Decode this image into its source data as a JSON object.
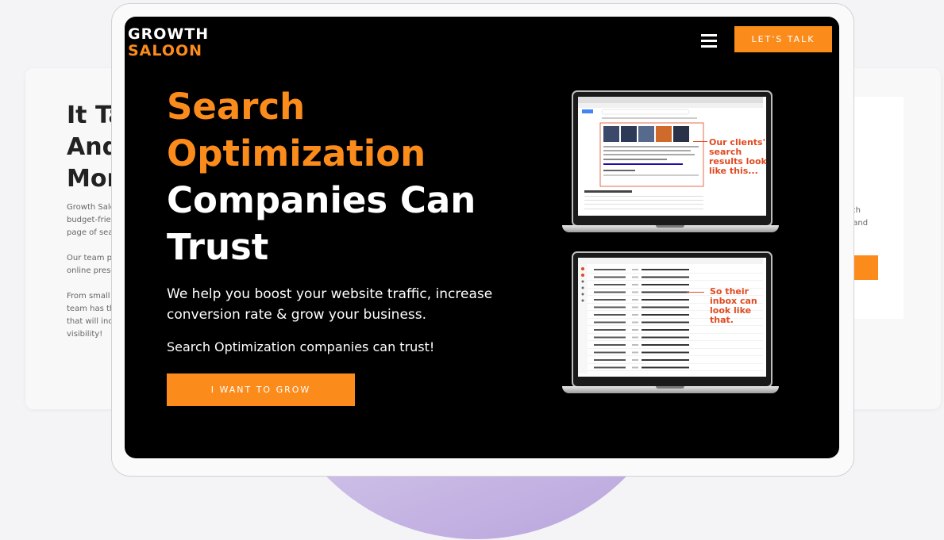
{
  "background_card_left": {
    "heading_lines": [
      "It Ta",
      "And",
      "More"
    ],
    "paragraphs": [
      [
        "Growth Saloon",
        "budget-friendly",
        "page of search"
      ],
      [
        "Our team prov",
        "online presenc"
      ],
      [
        "From small loc",
        "team has the",
        "that will increa",
        "visibility!"
      ]
    ]
  },
  "background_card_right": {
    "text_lines": [
      "earch",
      "ıst, and"
    ]
  },
  "nav": {
    "logo_top": "GROWTH",
    "logo_bottom": "SALOON",
    "cta_label": "LET'S TALK"
  },
  "hero": {
    "headline_orange_1": "Search",
    "headline_orange_2": "Optimization",
    "headline_white_1": "Companies Can",
    "headline_white_2": "Trust",
    "subtitle": "We help you boost your website traffic, increase conversion rate & grow your business.",
    "tagline": "Search Optimization companies can trust!",
    "cta_label": "I WANT TO GROW"
  },
  "illustration": {
    "search_annotation": [
      "Our clients'",
      "search",
      "results look",
      "like this..."
    ],
    "inbox_annotation": [
      "So their",
      "inbox can",
      "look like",
      "that."
    ]
  },
  "colors": {
    "accent": "#fb8c1c",
    "annotation": "#e04a20",
    "hero_background": "#000000"
  }
}
